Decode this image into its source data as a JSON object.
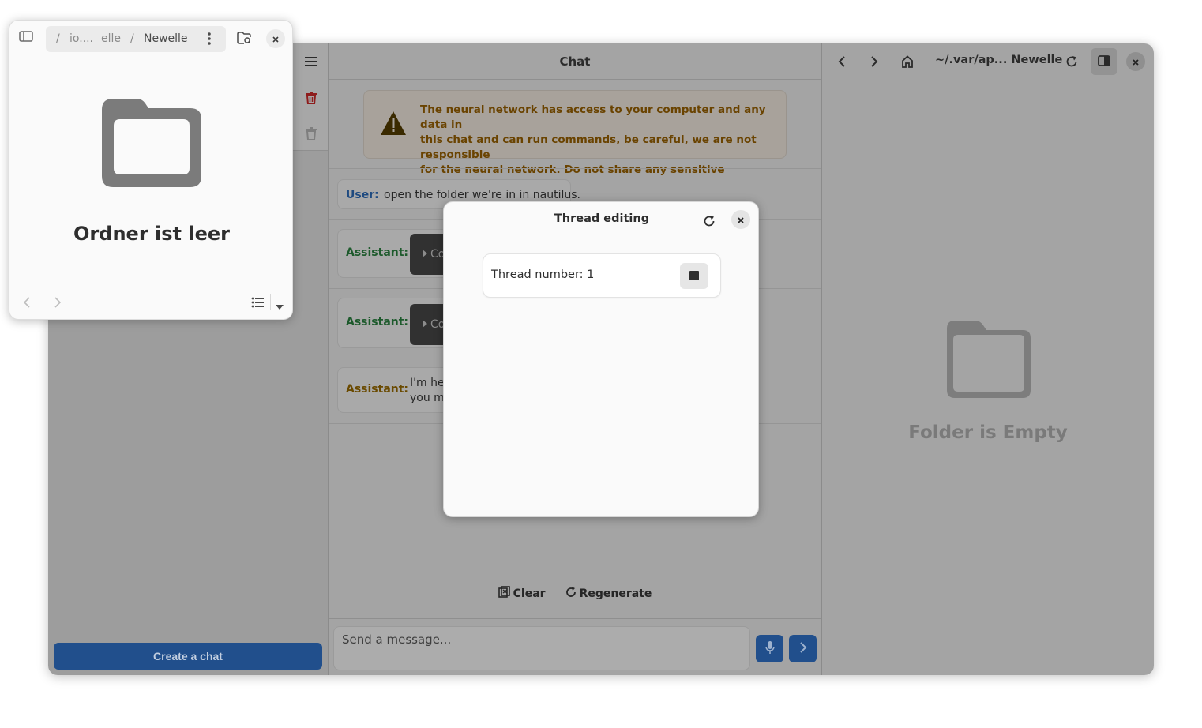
{
  "sidebar": {
    "create_chat_label": "Create a chat"
  },
  "chat": {
    "title": "Chat",
    "warning_lines": [
      "The neural network has access to your computer and any data in",
      "this chat and can run commands, be careful, we are not responsible",
      "for the neural network. Do not share any sensitive information."
    ],
    "messages": [
      {
        "role": "User:",
        "text": "open the folder we're in in nautilus."
      },
      {
        "role": "Assistant:",
        "chip": "Co"
      },
      {
        "role": "Assistant:",
        "chip": "Co"
      },
      {
        "role": "Assistant:",
        "text_lines": [
          "I'm her",
          "you ma"
        ]
      }
    ],
    "clear_label": "Clear",
    "regenerate_label": "Regenerate",
    "input_placeholder": "Send a message..."
  },
  "files": {
    "path_label": "~/.var/ap... Newelle",
    "empty_label": "Folder is Empty"
  },
  "dialog": {
    "title": "Thread editing",
    "thread_label": "Thread number: 1"
  },
  "nautilus": {
    "path_segments": [
      "/",
      "io....",
      "elle",
      "/",
      "Newelle"
    ],
    "empty_label": "Ordner ist leer"
  }
}
